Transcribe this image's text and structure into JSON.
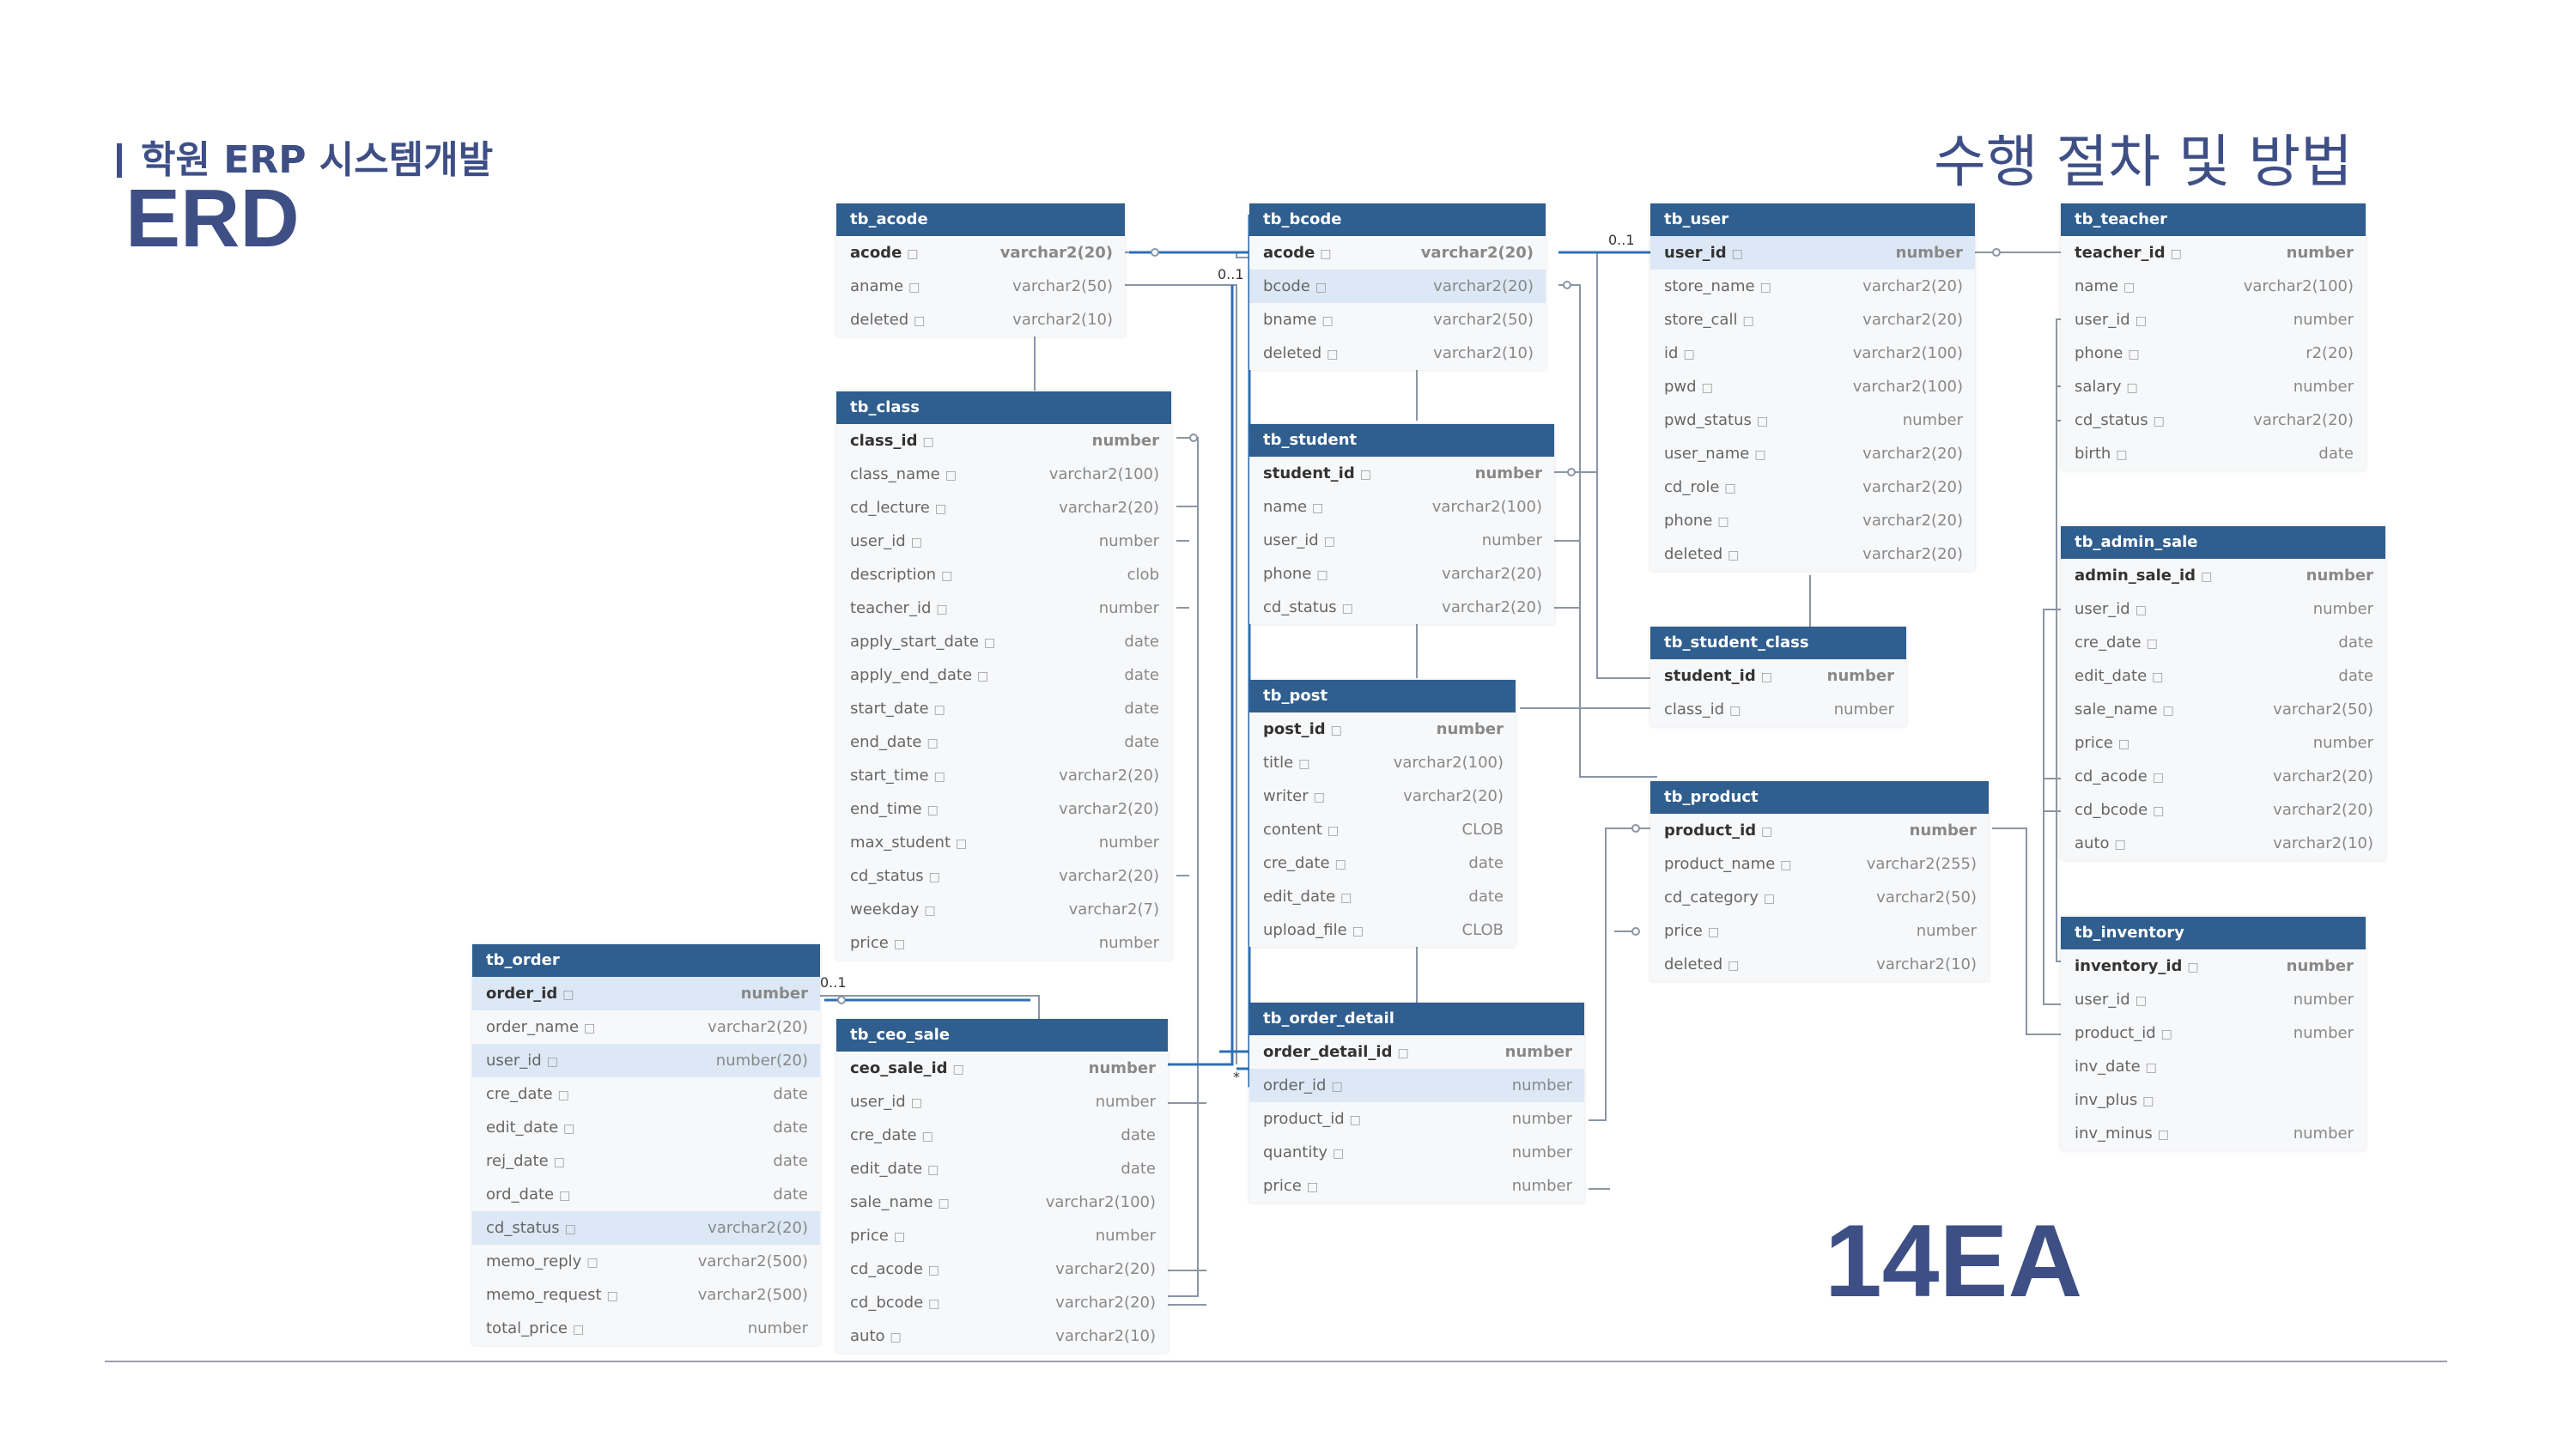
{
  "slide": {
    "subtitle": "학원 ERP 시스템개발",
    "title": "ERD",
    "section_title": "수행 절차 및 방법",
    "count_label": "14EA"
  },
  "tables": {
    "tb_acode": {
      "name": "tb_acode",
      "rows": [
        {
          "col": "acode",
          "type": "varchar2(20)"
        },
        {
          "col": "aname",
          "type": "varchar2(50)"
        },
        {
          "col": "deleted",
          "type": "varchar2(10)"
        }
      ]
    },
    "tb_bcode": {
      "name": "tb_bcode",
      "rows": [
        {
          "col": "acode",
          "type": "varchar2(20)"
        },
        {
          "col": "bcode",
          "type": "varchar2(20)"
        },
        {
          "col": "bname",
          "type": "varchar2(50)"
        },
        {
          "col": "deleted",
          "type": "varchar2(10)"
        }
      ]
    },
    "tb_user": {
      "name": "tb_user",
      "rows": [
        {
          "col": "user_id",
          "type": "number"
        },
        {
          "col": "store_name",
          "type": "varchar2(20)"
        },
        {
          "col": "store_call",
          "type": "varchar2(20)"
        },
        {
          "col": "id",
          "type": "varchar2(100)"
        },
        {
          "col": "pwd",
          "type": "varchar2(100)"
        },
        {
          "col": "pwd_status",
          "type": "number"
        },
        {
          "col": "user_name",
          "type": "varchar2(20)"
        },
        {
          "col": "cd_role",
          "type": "varchar2(20)"
        },
        {
          "col": "phone",
          "type": "varchar2(20)"
        },
        {
          "col": "deleted",
          "type": "varchar2(20)"
        }
      ]
    },
    "tb_teacher": {
      "name": "tb_teacher",
      "rows": [
        {
          "col": "teacher_id",
          "type": "number"
        },
        {
          "col": "name",
          "type": "varchar2(100)"
        },
        {
          "col": "user_id",
          "type": "number"
        },
        {
          "col": "phone",
          "type": "r2(20)"
        },
        {
          "col": "salary",
          "type": "number"
        },
        {
          "col": "cd_status",
          "type": "varchar2(20)"
        },
        {
          "col": "birth",
          "type": "date"
        }
      ]
    },
    "tb_class": {
      "name": "tb_class",
      "rows": [
        {
          "col": "class_id",
          "type": "number"
        },
        {
          "col": "class_name",
          "type": "varchar2(100)"
        },
        {
          "col": "cd_lecture",
          "type": "varchar2(20)"
        },
        {
          "col": "user_id",
          "type": "number"
        },
        {
          "col": "description",
          "type": "clob"
        },
        {
          "col": "teacher_id",
          "type": "number"
        },
        {
          "col": "apply_start_date",
          "type": "date"
        },
        {
          "col": "apply_end_date",
          "type": "date"
        },
        {
          "col": "start_date",
          "type": "date"
        },
        {
          "col": "end_date",
          "type": "date"
        },
        {
          "col": "start_time",
          "type": "varchar2(20)"
        },
        {
          "col": "end_time",
          "type": "varchar2(20)"
        },
        {
          "col": "max_student",
          "type": "number"
        },
        {
          "col": "cd_status",
          "type": "varchar2(20)"
        },
        {
          "col": "weekday",
          "type": "varchar2(7)"
        },
        {
          "col": "price",
          "type": "number"
        }
      ]
    },
    "tb_student": {
      "name": "tb_student",
      "rows": [
        {
          "col": "student_id",
          "type": "number"
        },
        {
          "col": "name",
          "type": "varchar2(100)"
        },
        {
          "col": "user_id",
          "type": "number"
        },
        {
          "col": "phone",
          "type": "varchar2(20)"
        },
        {
          "col": "cd_status",
          "type": "varchar2(20)"
        }
      ]
    },
    "tb_student_class": {
      "name": "tb_student_class",
      "rows": [
        {
          "col": "student_id",
          "type": "number"
        },
        {
          "col": "class_id",
          "type": "number"
        }
      ]
    },
    "tb_admin_sale": {
      "name": "tb_admin_sale",
      "rows": [
        {
          "col": "admin_sale_id",
          "type": "number"
        },
        {
          "col": "user_id",
          "type": "number"
        },
        {
          "col": "cre_date",
          "type": "date"
        },
        {
          "col": "edit_date",
          "type": "date"
        },
        {
          "col": "sale_name",
          "type": "varchar2(50)"
        },
        {
          "col": "price",
          "type": "number"
        },
        {
          "col": "cd_acode",
          "type": "varchar2(20)"
        },
        {
          "col": "cd_bcode",
          "type": "varchar2(20)"
        },
        {
          "col": "auto",
          "type": "varchar2(10)"
        }
      ]
    },
    "tb_post": {
      "name": "tb_post",
      "rows": [
        {
          "col": "post_id",
          "type": "number"
        },
        {
          "col": "title",
          "type": "varchar2(100)"
        },
        {
          "col": "writer",
          "type": "varchar2(20)"
        },
        {
          "col": "content",
          "type": "CLOB"
        },
        {
          "col": "cre_date",
          "type": "date"
        },
        {
          "col": "edit_date",
          "type": "date"
        },
        {
          "col": "upload_file",
          "type": "CLOB"
        }
      ]
    },
    "tb_product": {
      "name": "tb_product",
      "rows": [
        {
          "col": "product_id",
          "type": "number"
        },
        {
          "col": "product_name",
          "type": "varchar2(255)"
        },
        {
          "col": "cd_category",
          "type": "varchar2(50)"
        },
        {
          "col": "price",
          "type": "number"
        },
        {
          "col": "deleted",
          "type": "varchar2(10)"
        }
      ]
    },
    "tb_inventory": {
      "name": "tb_inventory",
      "rows": [
        {
          "col": "inventory_id",
          "type": "number"
        },
        {
          "col": "user_id",
          "type": "number"
        },
        {
          "col": "product_id",
          "type": "number"
        },
        {
          "col": "inv_date",
          "type": ""
        },
        {
          "col": "inv_plus",
          "type": ""
        },
        {
          "col": "inv_minus",
          "type": "number"
        }
      ]
    },
    "tb_order": {
      "name": "tb_order",
      "rows": [
        {
          "col": "order_id",
          "type": "number"
        },
        {
          "col": "order_name",
          "type": "varchar2(20)"
        },
        {
          "col": "user_id",
          "type": "number(20)"
        },
        {
          "col": "cre_date",
          "type": "date"
        },
        {
          "col": "edit_date",
          "type": "date"
        },
        {
          "col": "rej_date",
          "type": "date"
        },
        {
          "col": "ord_date",
          "type": "date"
        },
        {
          "col": "cd_status",
          "type": "varchar2(20)"
        },
        {
          "col": "memo_reply",
          "type": "varchar2(500)"
        },
        {
          "col": "memo_request",
          "type": "varchar2(500)"
        },
        {
          "col": "total_price",
          "type": "number"
        }
      ]
    },
    "tb_ceo_sale": {
      "name": "tb_ceo_sale",
      "rows": [
        {
          "col": "ceo_sale_id",
          "type": "number"
        },
        {
          "col": "user_id",
          "type": "number"
        },
        {
          "col": "cre_date",
          "type": "date"
        },
        {
          "col": "edit_date",
          "type": "date"
        },
        {
          "col": "sale_name",
          "type": "varchar2(100)"
        },
        {
          "col": "price",
          "type": "number"
        },
        {
          "col": "cd_acode",
          "type": "varchar2(20)"
        },
        {
          "col": "cd_bcode",
          "type": "varchar2(20)"
        },
        {
          "col": "auto",
          "type": "varchar2(10)"
        }
      ]
    },
    "tb_order_detail": {
      "name": "tb_order_detail",
      "rows": [
        {
          "col": "order_detail_id",
          "type": "number"
        },
        {
          "col": "order_id",
          "type": "number"
        },
        {
          "col": "product_id",
          "type": "number"
        },
        {
          "col": "quantity",
          "type": "number"
        },
        {
          "col": "price",
          "type": "number"
        }
      ]
    }
  },
  "cardinality_labels": {
    "bcode_acode": "0..1",
    "user_rel": "0..1",
    "order_rel": "0..1",
    "many": "*"
  }
}
